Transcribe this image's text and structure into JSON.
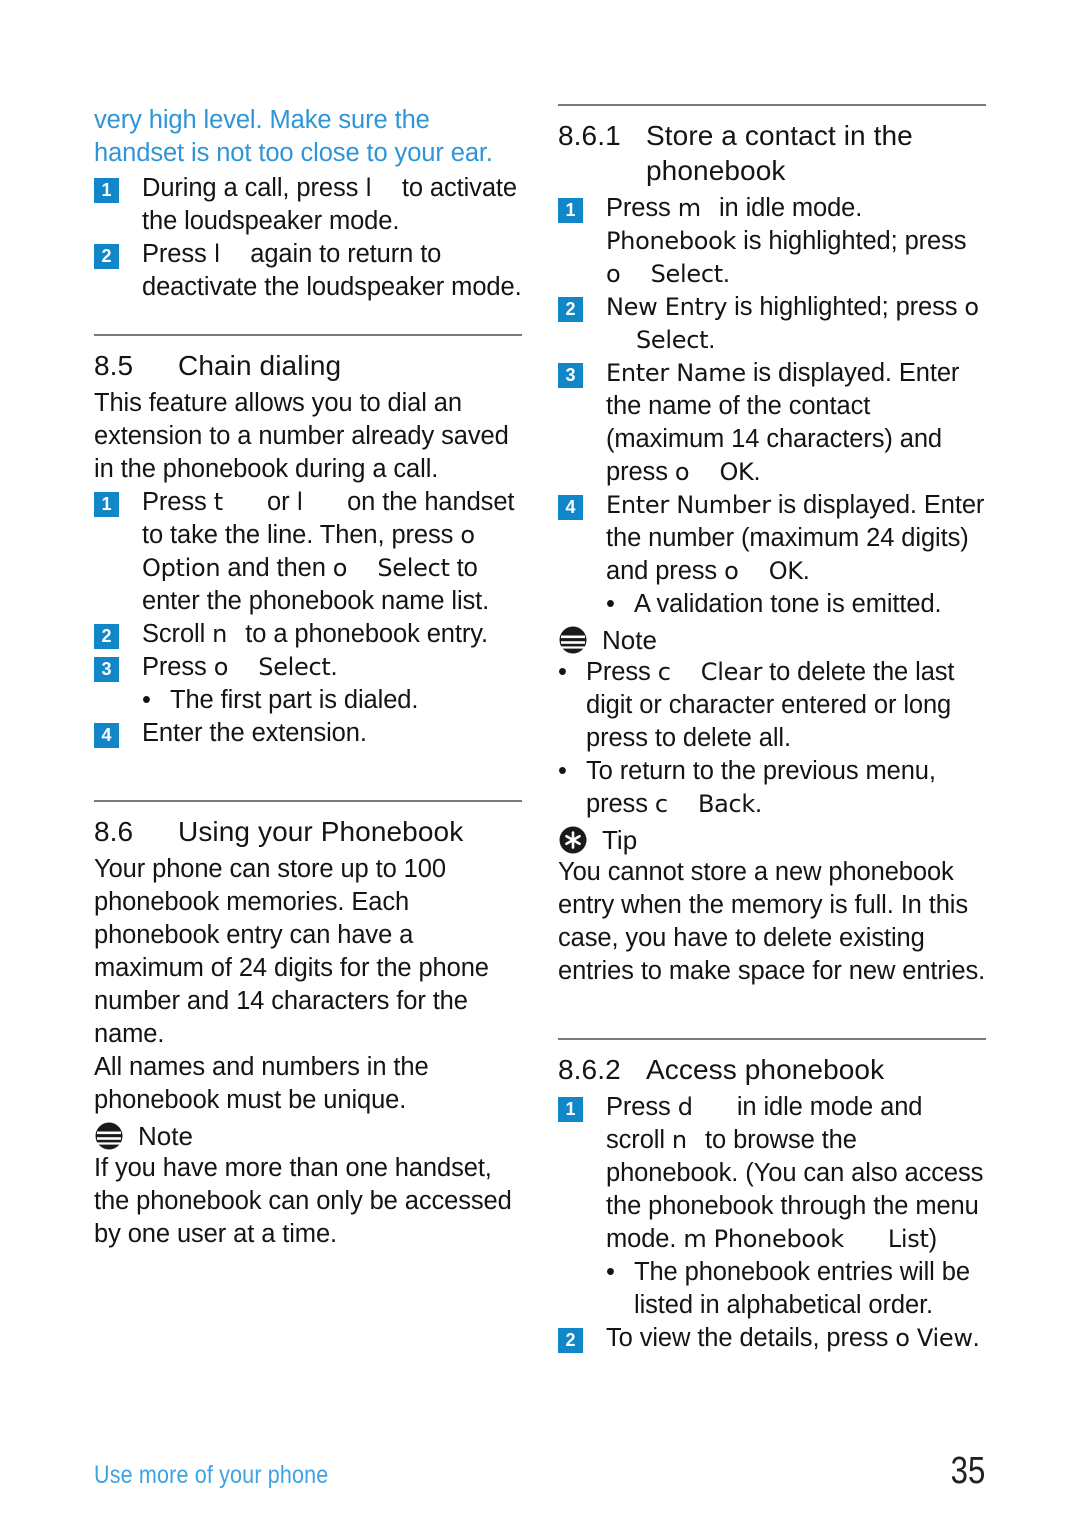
{
  "document": {
    "page_number": "35",
    "footer_label": "Use more of your phone"
  },
  "left_column": {
    "intro_warning": "very high level. Make sure the handset is not too close to your ear.",
    "loudspeaker_steps": [
      {
        "badge": "1",
        "pre": "During a call, press",
        "key": "l",
        "post": "to activate the loudspeaker mode."
      },
      {
        "badge": "2",
        "pre": "Press",
        "key": "l",
        "post": "again to return to deactivate the loudspeaker mode."
      }
    ],
    "section_85": {
      "number": "8.5",
      "title": "Chain dialing",
      "intro": "This feature allows you to dial an extension to a number already saved in the phonebook during a call.",
      "steps": [
        {
          "badge": "1",
          "t1": "Press",
          "k1": "t",
          "t2": "or",
          "k2": "l",
          "t3": "on the handset to take the line. Then, press",
          "k3": "o",
          "m1": "Option",
          "t4": "and then",
          "k4": "o",
          "m2": "Select",
          "t5": "to enter the phonebook name list."
        },
        {
          "badge": "2",
          "t1": "Scroll",
          "k1": "n",
          "t2": "to a phonebook entry."
        },
        {
          "badge": "3",
          "t1": "Press",
          "k1": "o",
          "m1": "Select",
          "t2": "."
        }
      ],
      "bullet_after_step3": "The first part is dialed.",
      "step4": {
        "badge": "4",
        "text": "Enter the extension."
      }
    },
    "section_86": {
      "number": "8.6",
      "title": "Using your Phonebook",
      "paragraph1": "Your phone can store up to 100 phonebook memories. Each phonebook entry can have a maximum of 24 digits for the phone number and 14 characters for the name.",
      "paragraph2": "All names and numbers in the phonebook must be unique.",
      "note": {
        "icon": "note-icon",
        "label": "Note",
        "text": "If you have more than one handset, the phonebook can only be accessed by one user at a time."
      }
    }
  },
  "right_column": {
    "section_861": {
      "number": "8.6.1",
      "title": "Store a contact in the phonebook",
      "steps": [
        {
          "badge": "1",
          "t1": "Press",
          "k1": "m",
          "t2": "in idle mode.",
          "m1": "Phonebook",
          "t3": "is highlighted; press",
          "k2": "o",
          "m2": "Select",
          "t4": "."
        },
        {
          "badge": "2",
          "m1": "New Entry",
          "t1": "is highlighted; press",
          "k1": "o",
          "m2": "Select",
          "t2": "."
        },
        {
          "badge": "3",
          "m1": "Enter Name",
          "t1": "is displayed. Enter the name of the contact (maximum 14 characters) and press",
          "k1": "o",
          "m2": "OK",
          "t2": "."
        },
        {
          "badge": "4",
          "m1": "Enter Number",
          "t1": "is displayed. Enter the number (maximum 24 digits) and press",
          "k1": "o",
          "m2": "OK",
          "t2": "."
        }
      ],
      "bullet_validation": "A validation tone is emitted.",
      "note": {
        "icon": "note-icon",
        "label": "Note",
        "bullets": [
          {
            "t1": "Press",
            "k1": "c",
            "m1": "Clear",
            "t2": "to delete the last digit or character entered or long press to delete all."
          },
          {
            "t1": "To return to the previous menu, press",
            "k1": "c",
            "m1": "Back",
            "t2": "."
          }
        ]
      },
      "tip": {
        "icon": "tip-icon",
        "label": "Tip",
        "text": "You cannot store a new phonebook entry when the memory is full. In this case, you have to delete existing entries to make space for new entries."
      }
    },
    "section_862": {
      "number": "8.6.2",
      "title": "Access phonebook",
      "steps": [
        {
          "badge": "1",
          "t1": "Press",
          "k1": "d",
          "t2": "in idle mode and scroll",
          "k2": "n",
          "t3": "to browse the phonebook. (You can also access the phonebook through the menu mode.",
          "k3": "m",
          "m1": "Phonebook",
          "m2": "List",
          "t4": ")"
        },
        {
          "badge": "2",
          "t1": "To view the details, press",
          "k1": "o",
          "m1": "View",
          "t2": "."
        }
      ],
      "bullet_order": "The phonebook entries will be listed in alphabetical order."
    }
  },
  "colors": {
    "accent_blue": "#2f95d6",
    "badge_blue": "#1186c8",
    "footer_blue": "#3ba3e3",
    "rule_gray": "#7b7b7b",
    "text_black": "#141414"
  }
}
